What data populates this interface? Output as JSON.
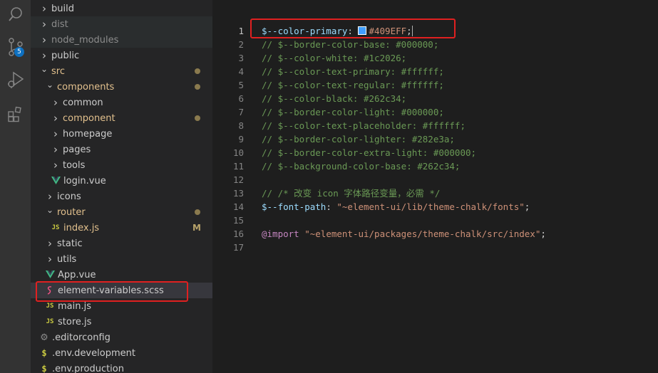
{
  "activity_bar": {
    "icons": [
      "search-icon",
      "source-control-icon",
      "run-debug-icon",
      "extensions-icon"
    ],
    "source_control_badge": "5"
  },
  "explorer": {
    "items": [
      {
        "label": "build",
        "type": "folder",
        "indent": 1
      },
      {
        "label": "dist",
        "type": "folder",
        "indent": 1,
        "dim": true
      },
      {
        "label": "node_modules",
        "type": "folder",
        "indent": 1,
        "dim": true
      },
      {
        "label": "public",
        "type": "folder",
        "indent": 1
      },
      {
        "label": "src",
        "type": "folder-open",
        "indent": 1,
        "color": "orange",
        "dot": true
      },
      {
        "label": "components",
        "type": "folder-open",
        "indent": 2,
        "color": "orange",
        "dot": true
      },
      {
        "label": "common",
        "type": "folder",
        "indent": 3
      },
      {
        "label": "component",
        "type": "folder",
        "indent": 3,
        "color": "orange",
        "dot": true
      },
      {
        "label": "homepage",
        "type": "folder",
        "indent": 3
      },
      {
        "label": "pages",
        "type": "folder",
        "indent": 3
      },
      {
        "label": "tools",
        "type": "folder",
        "indent": 3
      },
      {
        "label": "login.vue",
        "type": "vue",
        "indent": 3
      },
      {
        "label": "icons",
        "type": "folder",
        "indent": 2
      },
      {
        "label": "router",
        "type": "folder-open",
        "indent": 2,
        "color": "orange",
        "dot": true
      },
      {
        "label": "index.js",
        "type": "js",
        "indent": 3,
        "color": "orange",
        "badge": "M"
      },
      {
        "label": "static",
        "type": "folder",
        "indent": 2
      },
      {
        "label": "utils",
        "type": "folder",
        "indent": 2
      },
      {
        "label": "App.vue",
        "type": "vue",
        "indent": 2
      },
      {
        "label": "element-variables.scss",
        "type": "scss",
        "indent": 2,
        "selected": true
      },
      {
        "label": "main.js",
        "type": "js",
        "indent": 2
      },
      {
        "label": "store.js",
        "type": "js",
        "indent": 2
      },
      {
        "label": ".editorconfig",
        "type": "gear",
        "indent": 1
      },
      {
        "label": ".env.development",
        "type": "env",
        "indent": 1
      },
      {
        "label": ".env.production",
        "type": "env",
        "indent": 1
      }
    ]
  },
  "icons": {
    "js": "JS",
    "env": "$"
  },
  "editor": {
    "colors": {
      "primary_swatch": "#409EFF"
    },
    "lines": [
      {
        "num": "1",
        "active": true,
        "tokens": [
          [
            "var",
            "$--color-primary"
          ],
          [
            "pun",
            ": "
          ],
          [
            "swatch",
            ""
          ],
          [
            "num",
            "#409EFF"
          ],
          [
            "pun",
            ";"
          ],
          [
            "caret",
            ""
          ]
        ]
      },
      {
        "num": "2",
        "tokens": [
          [
            "cm",
            "// $--border-color-base: #000000;"
          ]
        ]
      },
      {
        "num": "3",
        "tokens": [
          [
            "cm",
            "// $--color-white: #1c2026;"
          ]
        ]
      },
      {
        "num": "4",
        "tokens": [
          [
            "cm",
            "// $--color-text-primary: #ffffff;"
          ]
        ]
      },
      {
        "num": "5",
        "tokens": [
          [
            "cm",
            "// $--color-text-regular: #ffffff;"
          ]
        ]
      },
      {
        "num": "6",
        "tokens": [
          [
            "cm",
            "// $--color-black: #262c34;"
          ]
        ]
      },
      {
        "num": "7",
        "tokens": [
          [
            "cm",
            "// $--border-color-light: #000000;"
          ]
        ]
      },
      {
        "num": "8",
        "tokens": [
          [
            "cm",
            "// $--color-text-placeholder: #ffffff;"
          ]
        ]
      },
      {
        "num": "9",
        "tokens": [
          [
            "cm",
            "// $--border-color-lighter: #282e3a;"
          ]
        ]
      },
      {
        "num": "10",
        "tokens": [
          [
            "cm",
            "// $--border-color-extra-light: #000000;"
          ]
        ]
      },
      {
        "num": "11",
        "tokens": [
          [
            "cm",
            "// $--background-color-base: #262c34;"
          ]
        ]
      },
      {
        "num": "12",
        "tokens": []
      },
      {
        "num": "13",
        "tokens": [
          [
            "cm",
            "// /* 改变 icon 字体路径变量，必需 */"
          ]
        ]
      },
      {
        "num": "14",
        "tokens": [
          [
            "var",
            "$--font-path"
          ],
          [
            "pun",
            ": "
          ],
          [
            "str",
            "\"~element-ui/lib/theme-chalk/fonts\""
          ],
          [
            "pun",
            ";"
          ]
        ]
      },
      {
        "num": "15",
        "tokens": []
      },
      {
        "num": "16",
        "tokens": [
          [
            "kw",
            "@import"
          ],
          [
            "pun",
            " "
          ],
          [
            "str",
            "\"~element-ui/packages/theme-chalk/src/index\""
          ],
          [
            "pun",
            ";"
          ]
        ]
      },
      {
        "num": "17",
        "tokens": []
      }
    ]
  }
}
